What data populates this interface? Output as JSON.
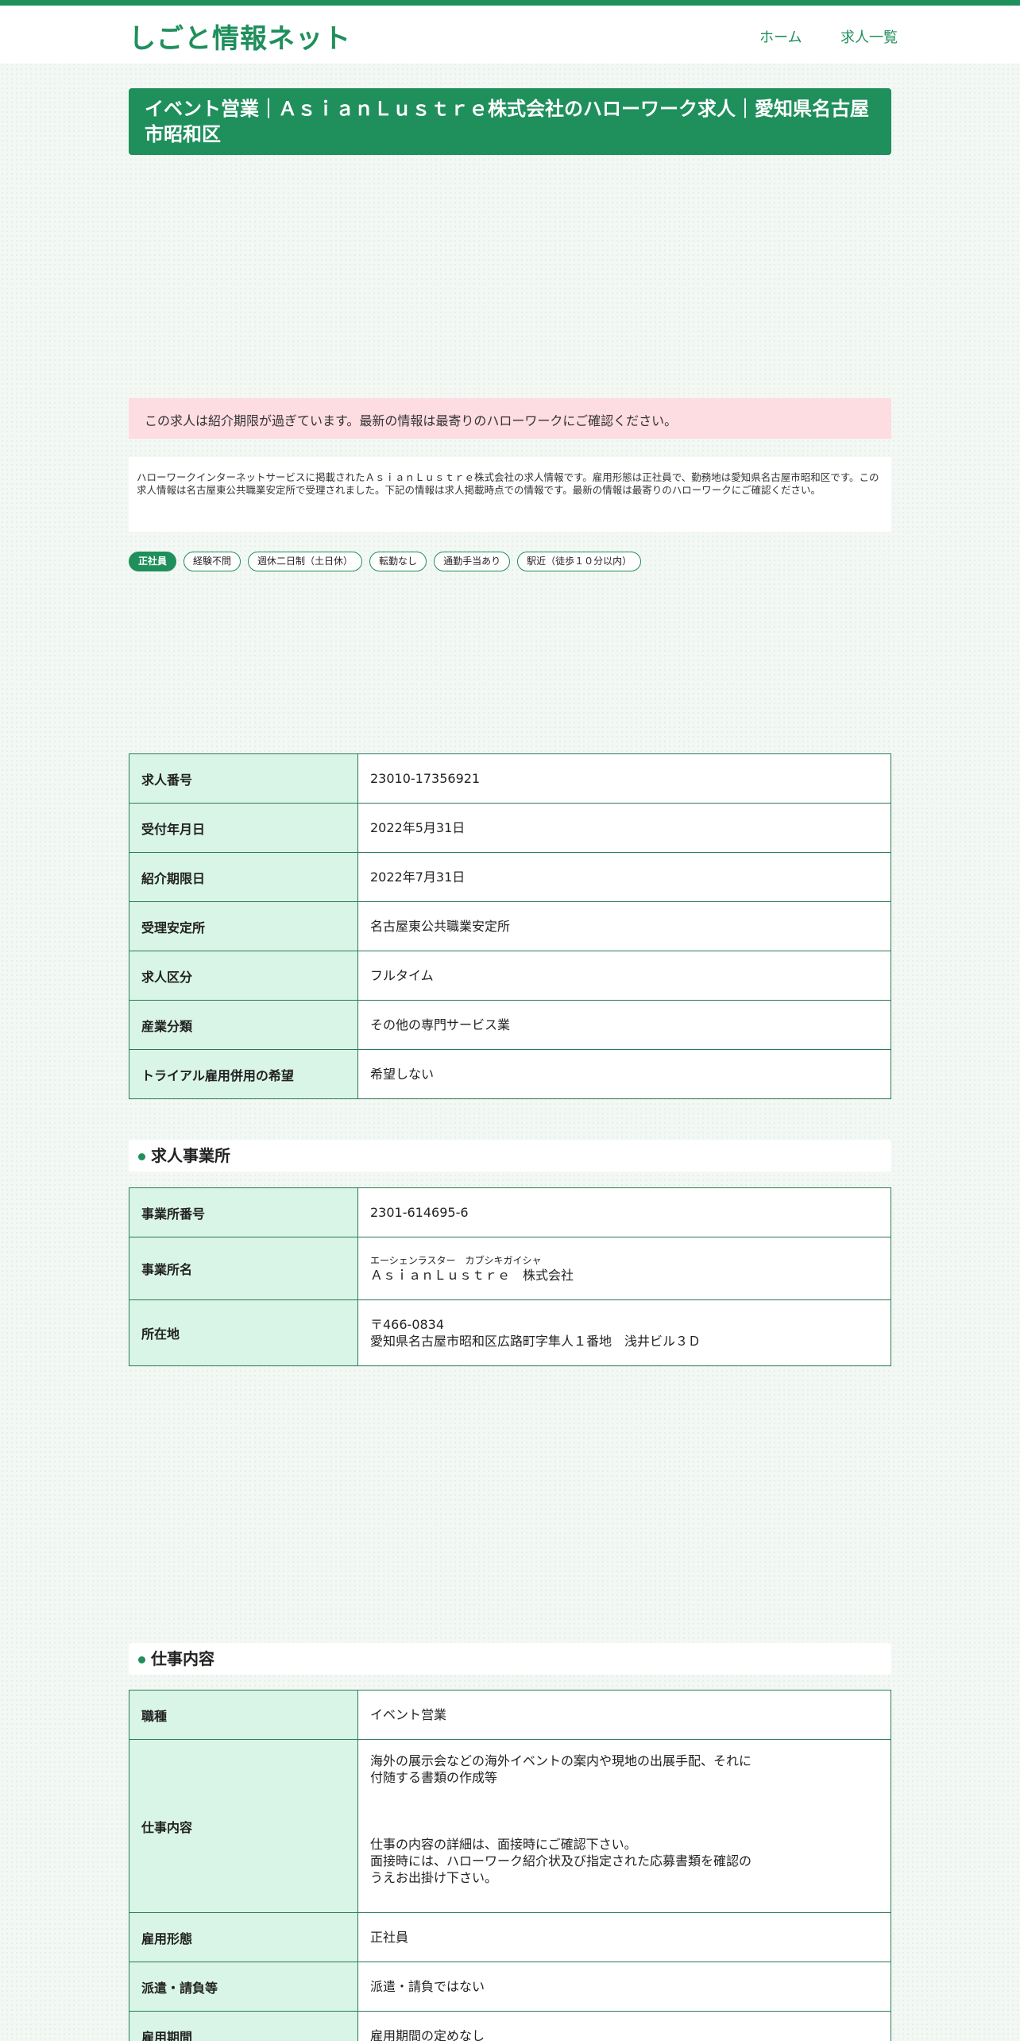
{
  "site": {
    "title": "しごと情報ネット",
    "nav": {
      "home": "ホーム",
      "list": "求人一覧"
    }
  },
  "page_title": "イベント営業｜ＡｓｉａｎＬｕｓｔｒｅ株式会社のハローワーク求人｜愛知県名古屋市昭和区",
  "notice": "この求人は紹介期限が過ぎています。最新の情報は最寄りのハローワークにご確認ください。",
  "description": "ハローワークインターネットサービスに掲載されたＡｓｉａｎＬｕｓｔｒｅ株式会社の求人情報です。雇用形態は正社員で、勤務地は愛知県名古屋市昭和区です。この求人情報は名古屋東公共職業安定所で受理されました。下記の情報は求人掲載時点での情報です。最新の情報は最寄りのハローワークにご確認ください。",
  "tags": [
    "正社員",
    "経験不問",
    "週休二日制（土日休）",
    "転勤なし",
    "通勤手当あり",
    "駅近（徒歩１０分以内）"
  ],
  "basic_info": [
    {
      "label": "求人番号",
      "value": "23010-17356921"
    },
    {
      "label": "受付年月日",
      "value": "2022年5月31日"
    },
    {
      "label": "紹介期限日",
      "value": "2022年7月31日"
    },
    {
      "label": "受理安定所",
      "value": "名古屋東公共職業安定所"
    },
    {
      "label": "求人区分",
      "value": "フルタイム"
    },
    {
      "label": "産業分類",
      "value": "その他の専門サービス業"
    },
    {
      "label": "トライアル雇用併用の希望",
      "value": "希望しない"
    }
  ],
  "employer": {
    "section_title": "求人事業所",
    "office_number_label": "事業所番号",
    "office_number": "2301-614695-6",
    "name_label": "事業所名",
    "name_kana": "エーシェンラスター　カブシキガイシャ",
    "name": "ＡｓｉａｎＬｕｓｔｒｅ　株式会社",
    "address_label": "所在地",
    "postal": "〒466-0834",
    "address": "愛知県名古屋市昭和区広路町字隼人１番地　浅井ビル３Ｄ"
  },
  "job": {
    "section_title": "仕事内容",
    "occupation_label": "職種",
    "occupation": "イベント営業",
    "content_label": "仕事内容",
    "content_line1": "海外の展示会などの海外イベントの案内や現地の出展手配、それに",
    "content_line2": "付随する書類の作成等",
    "content_line3": "仕事の内容の詳細は、面接時にご確認下さい。",
    "content_line4": "面接時には、ハローワーク紹介状及び指定された応募書類を確認の",
    "content_line5": "うえお出掛け下さい。",
    "employment_type_label": "雇用形態",
    "employment_type": "正社員",
    "dispatch_label": "派遣・請負等",
    "dispatch": "派遣・請負ではない",
    "period_label": "雇用期間",
    "period": "雇用期間の定めなし"
  },
  "colors": {
    "accent": "#1f8f5c",
    "header_cell": "#d9f5e7",
    "notice_bg": "#fddce2"
  }
}
